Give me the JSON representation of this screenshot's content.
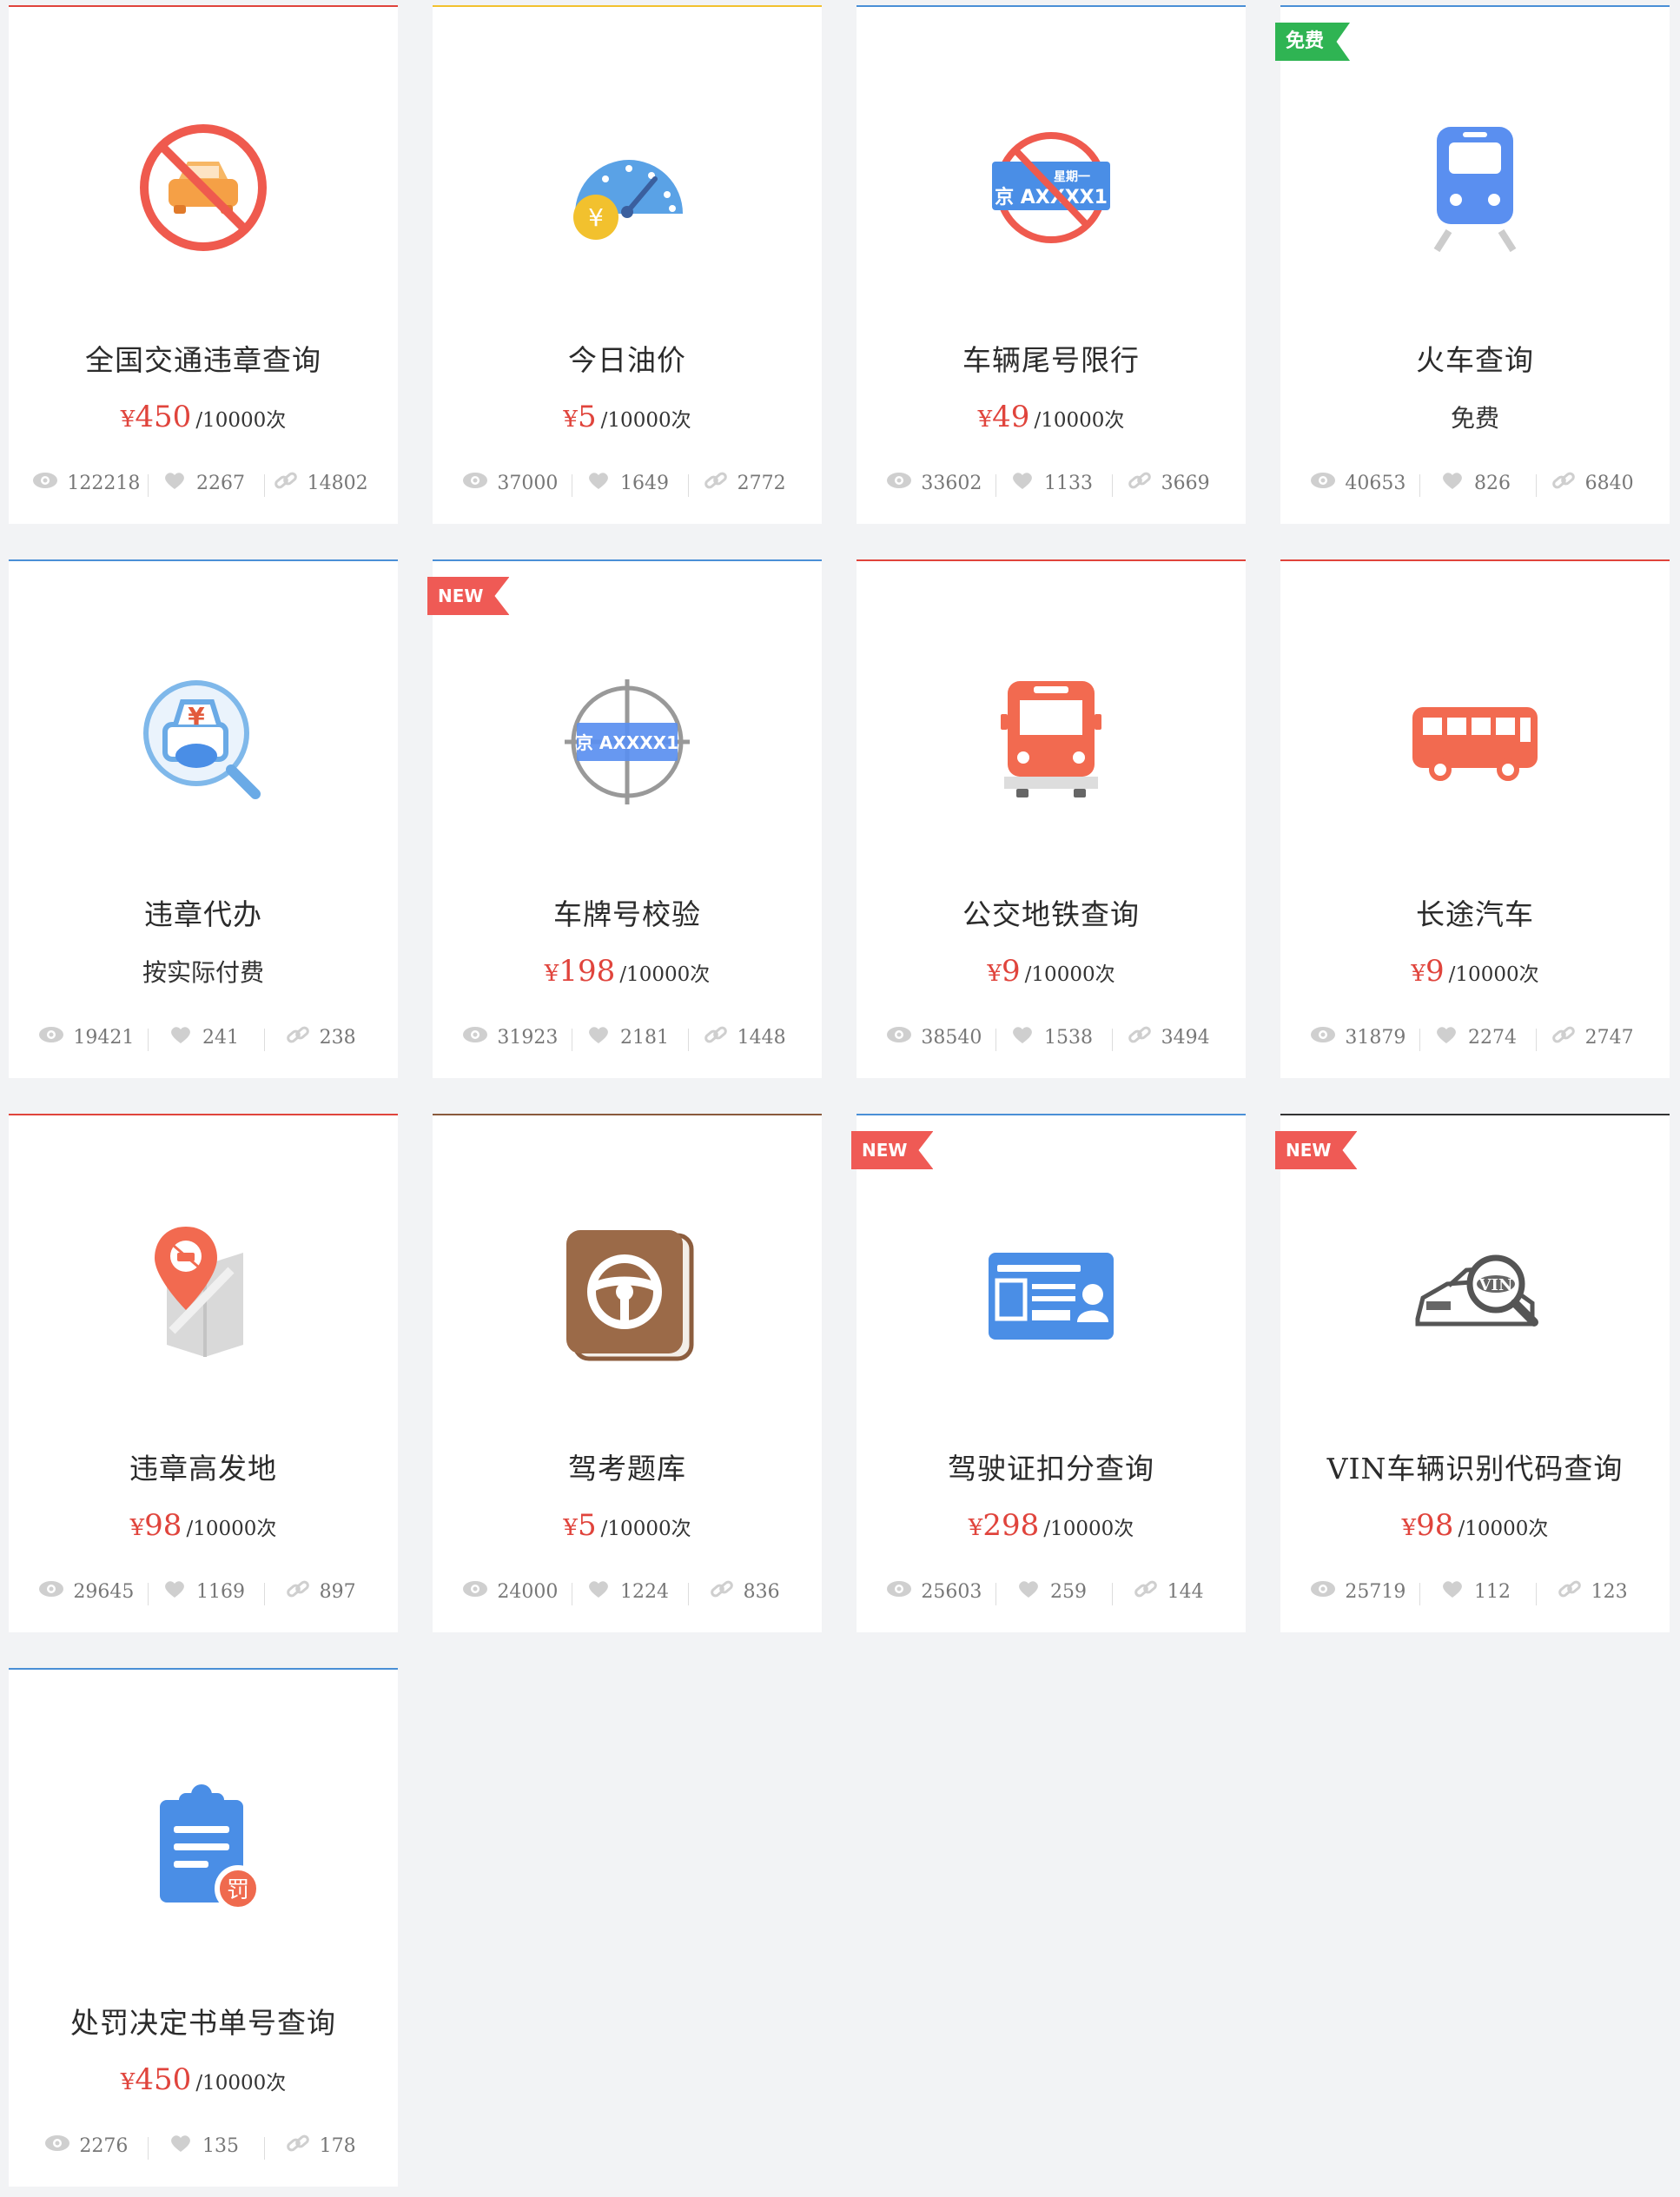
{
  "cards": [
    {
      "title": "全国交通违章查询",
      "price": {
        "symbol": "¥",
        "amount": "450",
        "unit": "/10000次"
      },
      "stats": {
        "views": "122218",
        "likes": "2267",
        "links": "14802"
      },
      "accent": "#e0443c",
      "icon": "no-car-icon"
    },
    {
      "title": "今日油价",
      "price": {
        "symbol": "¥",
        "amount": "5",
        "unit": "/10000次"
      },
      "stats": {
        "views": "37000",
        "likes": "1649",
        "links": "2772"
      },
      "accent": "#f2c12e",
      "icon": "fuel-gauge-icon"
    },
    {
      "title": "车辆尾号限行",
      "price": {
        "symbol": "¥",
        "amount": "49",
        "unit": "/10000次"
      },
      "stats": {
        "views": "33602",
        "likes": "1133",
        "links": "3669"
      },
      "accent": "#4a8fd6",
      "icon": "plate-restriction-icon",
      "plate_text": "京 AXXXX1",
      "plate_day": "星期一"
    },
    {
      "title": "火车查询",
      "price_text": "免费",
      "stats": {
        "views": "40653",
        "likes": "826",
        "links": "6840"
      },
      "accent": "#4a8fd6",
      "icon": "train-icon",
      "badge": "免费"
    },
    {
      "title": "违章代办",
      "price_text": "按实际付费",
      "stats": {
        "views": "19421",
        "likes": "241",
        "links": "238"
      },
      "accent": "#4a8fd6",
      "icon": "violation-agent-icon"
    },
    {
      "title": "车牌号校验",
      "price": {
        "symbol": "¥",
        "amount": "198",
        "unit": "/10000次"
      },
      "stats": {
        "views": "31923",
        "likes": "2181",
        "links": "1448"
      },
      "accent": "#4a8fd6",
      "icon": "plate-target-icon",
      "badge": "NEW",
      "plate_text": "京 AXXXX1"
    },
    {
      "title": "公交地铁查询",
      "price": {
        "symbol": "¥",
        "amount": "9",
        "unit": "/10000次"
      },
      "stats": {
        "views": "38540",
        "likes": "1538",
        "links": "3494"
      },
      "accent": "#e0443c",
      "icon": "bus-front-icon"
    },
    {
      "title": "长途汽车",
      "price": {
        "symbol": "¥",
        "amount": "9",
        "unit": "/10000次"
      },
      "stats": {
        "views": "31879",
        "likes": "2274",
        "links": "2747"
      },
      "accent": "#e0443c",
      "icon": "coach-bus-icon"
    },
    {
      "title": "违章高发地",
      "price": {
        "symbol": "¥",
        "amount": "98",
        "unit": "/10000次"
      },
      "stats": {
        "views": "29645",
        "likes": "1169",
        "links": "897"
      },
      "accent": "#e0443c",
      "icon": "map-pin-icon"
    },
    {
      "title": "驾考题库",
      "price": {
        "symbol": "¥",
        "amount": "5",
        "unit": "/10000次"
      },
      "stats": {
        "views": "24000",
        "likes": "1224",
        "links": "836"
      },
      "accent": "#8a5a3c",
      "icon": "steering-wheel-book-icon"
    },
    {
      "title": "驾驶证扣分查询",
      "price": {
        "symbol": "¥",
        "amount": "298",
        "unit": "/10000次"
      },
      "stats": {
        "views": "25603",
        "likes": "259",
        "links": "144"
      },
      "accent": "#4a8fd6",
      "icon": "license-card-icon",
      "badge": "NEW"
    },
    {
      "title": "VIN车辆识别代码查询",
      "price": {
        "symbol": "¥",
        "amount": "98",
        "unit": "/10000次"
      },
      "stats": {
        "views": "25719",
        "likes": "112",
        "links": "123"
      },
      "accent": "#333333",
      "icon": "vin-car-icon",
      "badge": "NEW",
      "vin_text": "VIN"
    },
    {
      "title": "处罚决定书单号查询",
      "price": {
        "symbol": "¥",
        "amount": "450",
        "unit": "/10000次"
      },
      "stats": {
        "views": "2276",
        "likes": "135",
        "links": "178"
      },
      "accent": "#4a8fd6",
      "icon": "penalty-clipboard-icon",
      "stamp_text": "罚"
    }
  ],
  "icon_glyphs": {
    "yen": "¥"
  }
}
